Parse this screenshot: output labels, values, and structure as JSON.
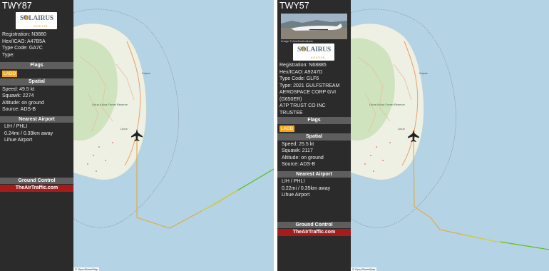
{
  "colors": {
    "sidebar": "#2b2b2b",
    "sea": "#b4d3e4",
    "land": "#eef0e4",
    "badge": "#f0a81c",
    "cta": "#a81b1b"
  },
  "left": {
    "callsign": "TWY87",
    "logo": {
      "brand": "SOLAIRUS",
      "sub": "AVIATION"
    },
    "registration": "Registration: N3880",
    "hex": "Hex/ICAO: A47B5A",
    "type_code": "Type Code: GA7C",
    "type": "Type:",
    "flags_title": "Flags",
    "flag": "LADD",
    "spatial_title": "Spatial",
    "speed": "Speed: 49.5 kt",
    "squawk": "Squawk: 2274",
    "altitude": "Altitude: on ground",
    "source": "Source: ADS-B",
    "airport_title": "Nearest Airport",
    "airport_code": "LIH / PHLI",
    "airport_dist": "0.24mi / 0.39km away",
    "airport_name": "Lihue Airport",
    "ground_title": "Ground Control",
    "site": "TheAirTraffic.com",
    "attribution": "© OpenStreetMap",
    "map_labels": {
      "park": "Lihue-Koloa Forest Reserve",
      "town1": "Kapaa",
      "town2": "Lihue"
    }
  },
  "right": {
    "callsign": "TWY57",
    "photo_caption": "Image © AvioNorthoBank",
    "logo": {
      "brand": "SOLAIRUS",
      "sub": "AVIATION"
    },
    "registration": "Registration: N68885",
    "hex": "Hex/ICAO: A9247D",
    "type_code": "Type Code: GLF6",
    "type": "Type: 2021 GULFSTREAM AEROSPACE CORP GVI (G650ER)",
    "owner": "A7P TRUST CO INC TRUSTEE",
    "flags_title": "Flags",
    "flag": "LADD",
    "spatial_title": "Spatial",
    "speed": "Speed: 25.5 kt",
    "squawk": "Squawk: 2117",
    "altitude": "Altitude: on ground",
    "source": "Source: ADS-B",
    "airport_title": "Nearest Airport",
    "airport_code": "LIH / PHLI",
    "airport_dist": "0.22mi / 0.35km away",
    "airport_name": "Lihue Airport",
    "ground_title": "Ground Control",
    "site": "TheAirTraffic.com",
    "attribution": "© OpenStreetMap",
    "map_labels": {
      "park": "Lihue-Koloa Forest Reserve",
      "town1": "Kapaa",
      "town2": "Lihue"
    }
  }
}
